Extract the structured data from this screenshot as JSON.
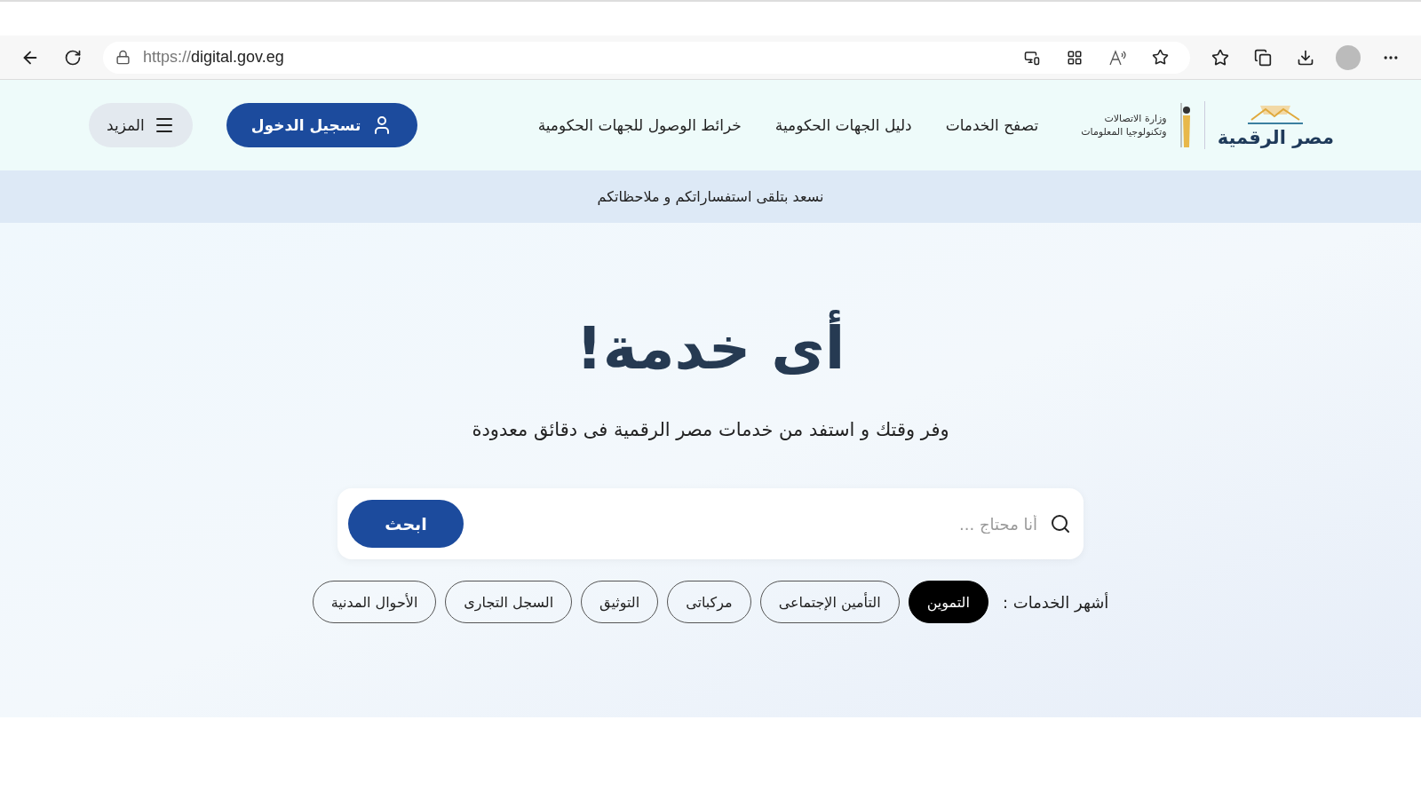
{
  "browser": {
    "url_scheme": "https://",
    "url_host": "digital.gov.eg"
  },
  "header": {
    "logo": {
      "name": "مصر الرقمية",
      "ministry_line_1": "وزارة الاتصالات",
      "ministry_line_2": "وتكنولوجيا المعلومات"
    },
    "nav": [
      "تصفح الخدمات",
      "دليل الجهات الحكومية",
      "خرائط الوصول للجهات الحكومية"
    ],
    "login_button": "تسجيل الدخول",
    "more_button": "المزيد"
  },
  "banner": "نسعد بتلقى استفساراتكم و ملاحظاتكم",
  "hero": {
    "title": "أى خدمة!",
    "subtitle": "وفر وقتك و استفد من خدمات مصر الرقمية فى دقائق معدودة",
    "search": {
      "placeholder": "أنا محتاج ...",
      "button": "ابحث"
    },
    "popular_label": "أشهر الخدمات :",
    "popular": [
      {
        "label": "التموين",
        "selected": true
      },
      {
        "label": "التأمين الإجتماعى",
        "selected": false
      },
      {
        "label": "مركباتى",
        "selected": false
      },
      {
        "label": "التوثيق",
        "selected": false
      },
      {
        "label": "السجل التجارى",
        "selected": false
      },
      {
        "label": "الأحوال المدنية",
        "selected": false
      }
    ]
  }
}
